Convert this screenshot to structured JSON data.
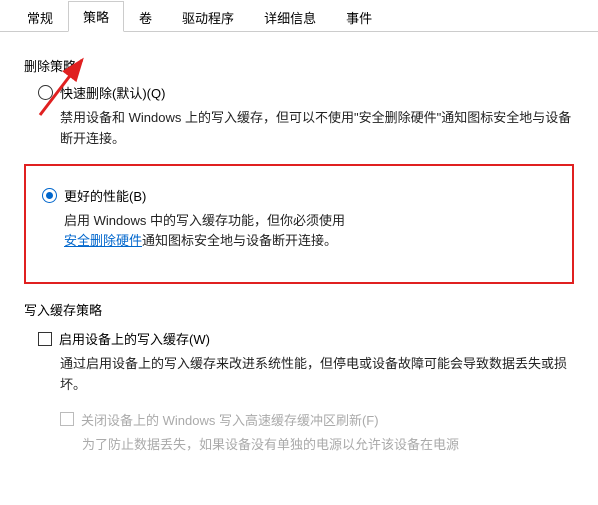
{
  "tabs": {
    "general": "常规",
    "policy": "策略",
    "volumes": "卷",
    "driver": "驱动程序",
    "details": "详细信息",
    "events": "事件"
  },
  "removal_policy": {
    "legend": "删除策略",
    "quick": {
      "label": "快速删除(默认)(Q)",
      "desc": "禁用设备和 Windows 上的写入缓存，但可以不使用\"安全删除硬件\"通知图标安全地与设备断开连接。"
    },
    "better": {
      "label": "更好的性能(B)",
      "desc_pre": "启用 Windows 中的写入缓存功能，但你必须使用",
      "link": "安全删除硬件",
      "desc_post": "通知图标安全地与设备断开连接。"
    }
  },
  "write_cache": {
    "legend": "写入缓存策略",
    "enable": {
      "label": "启用设备上的写入缓存(W)",
      "desc": "通过启用设备上的写入缓存来改进系统性能，但停电或设备故障可能会导致数据丢失或损坏。"
    },
    "flush": {
      "label": "关闭设备上的 Windows 写入高速缓存缓冲区刷新(F)",
      "desc": "为了防止数据丢失，如果设备没有单独的电源以允许该设备在电源"
    }
  }
}
